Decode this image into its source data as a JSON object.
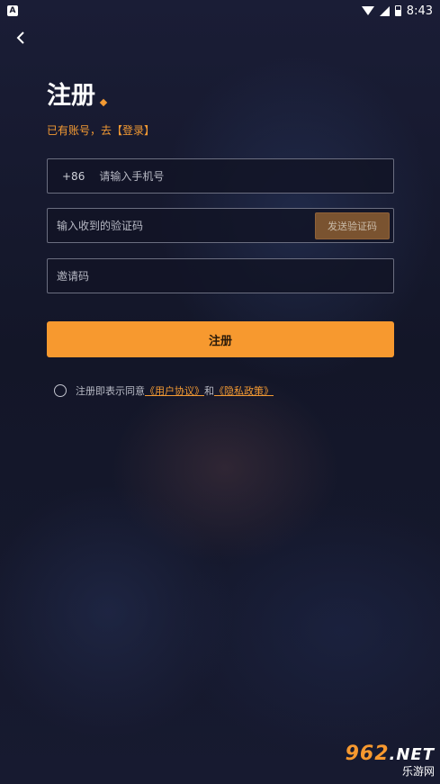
{
  "status_bar": {
    "app_indicator": "A",
    "time": "8:43"
  },
  "header": {
    "title": "注册",
    "login_prompt": "已有账号，去",
    "login_link": "【登录】"
  },
  "form": {
    "phone_prefix": "+86",
    "phone_placeholder": "请输入手机号",
    "code_placeholder": "输入收到的验证码",
    "send_code_label": "发送验证码",
    "invite_placeholder": "邀请码",
    "submit_label": "注册"
  },
  "agreement": {
    "prefix": "注册即表示同意",
    "user_agreement": "《用户协议》",
    "conjunction": "和",
    "privacy_policy": "《隐私政策》"
  },
  "watermark": {
    "brand": "962",
    "suffix": ".NET",
    "site": "乐游网"
  },
  "colors": {
    "accent": "#f7992f",
    "background": "#14162a"
  }
}
